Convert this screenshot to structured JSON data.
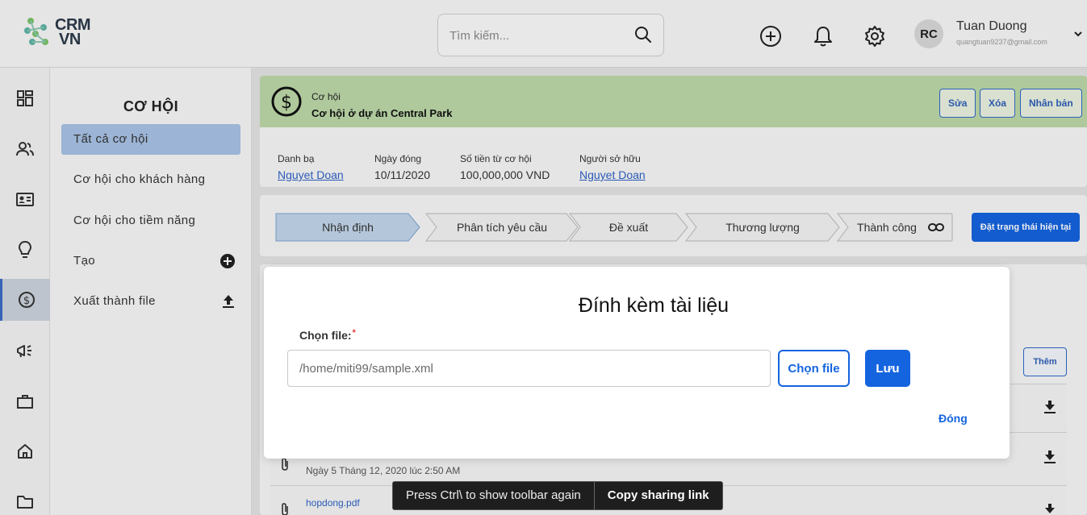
{
  "app": {
    "logo_line1": "CRM",
    "logo_line2": "VN"
  },
  "header": {
    "search_placeholder": "Tìm kiếm...",
    "avatar_initials": "RC",
    "user_name": "Tuan Duong",
    "user_email": "quangtuan9237@gmail.com"
  },
  "sidebar": {
    "title": "CƠ HỘI",
    "items": [
      {
        "label": "Tất cả cơ hội"
      },
      {
        "label": "Cơ hội cho khách hàng"
      },
      {
        "label": "Cơ hội cho tiềm năng"
      },
      {
        "label": "Tạo"
      },
      {
        "label": "Xuất thành file"
      }
    ]
  },
  "record": {
    "type": "Cơ hội",
    "name": "Cơ hội ở dự án Central Park",
    "actions": {
      "edit": "Sửa",
      "delete": "Xóa",
      "duplicate": "Nhân bản"
    },
    "fields": [
      {
        "label": "Danh bạ",
        "value": "Nguyet Doan"
      },
      {
        "label": "Ngày đóng",
        "value": "10/11/2020"
      },
      {
        "label": "Số tiền từ cơ hội",
        "value": "100,000,000 VND"
      },
      {
        "label": "Người sở hữu",
        "value": "Nguyet Doan"
      }
    ]
  },
  "stages": {
    "items": [
      {
        "label": "Nhận định"
      },
      {
        "label": "Phân tích yêu cầu"
      },
      {
        "label": "Đề xuất"
      },
      {
        "label": "Thương lượng"
      },
      {
        "label": "Thành công"
      }
    ],
    "set_current_label": "Đặt trạng thái hiện tại"
  },
  "attachments": {
    "add_label": "Thêm",
    "rows": [
      {
        "date": "Ngày 5 Tháng 12, 2020 lúc 2:50 AM"
      },
      {
        "file": "hopdong.pdf"
      }
    ]
  },
  "modal": {
    "title": "Đính kèm tài liệu",
    "field_label": "Chọn file:",
    "required_mark": "*",
    "file_value": "/home/miti99/sample.xml",
    "choose_label": "Chọn file",
    "save_label": "Lưu",
    "close_label": "Đóng"
  },
  "toast": {
    "message": "Press Ctrl\\ to show toolbar again",
    "link": "Copy sharing link"
  },
  "colors": {
    "primary": "#1564df",
    "record_header": "#bdd9a8",
    "active_sidebar": "#a8c2e6"
  }
}
